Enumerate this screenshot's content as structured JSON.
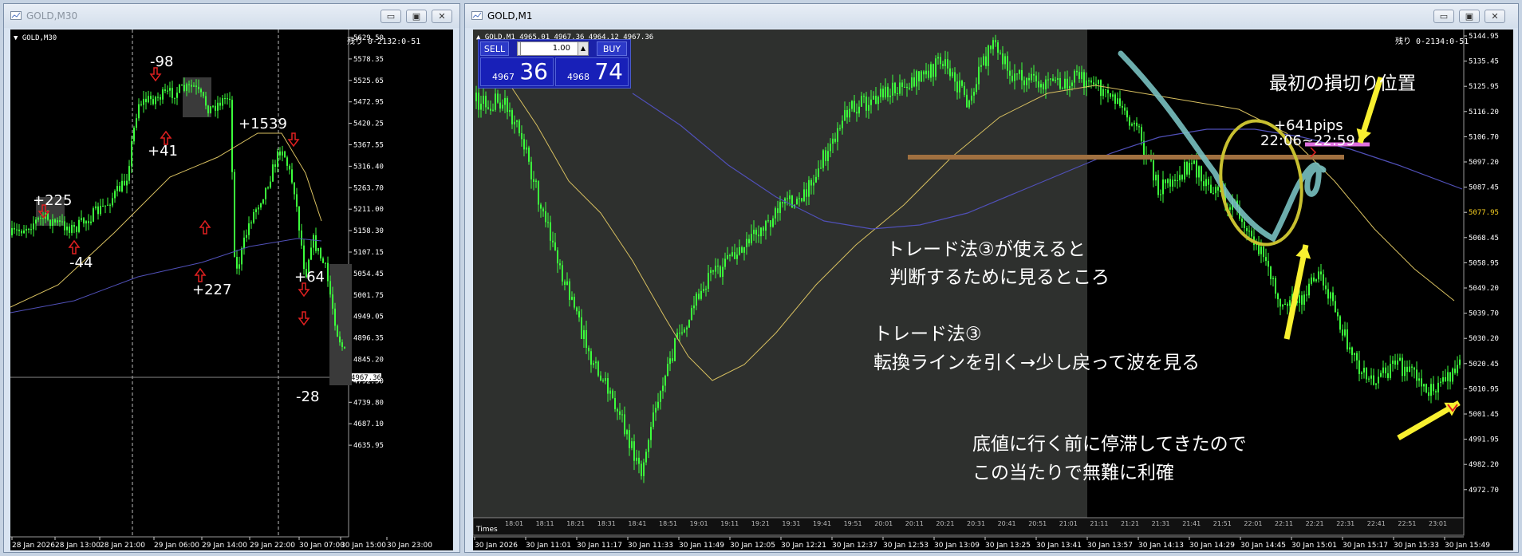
{
  "left_window": {
    "title": "GOLD,M30",
    "chart_label": "GOLD,M30",
    "countdown": "残り 0-2132:0-51",
    "current_price": "4967.36",
    "price_axis": [
      "5629.50",
      "5578.35",
      "5525.65",
      "5472.95",
      "5420.25",
      "5367.55",
      "5316.40",
      "5263.70",
      "5211.00",
      "5158.30",
      "5107.15",
      "5054.45",
      "5001.75",
      "4949.05",
      "4896.35",
      "4845.20",
      "4792.50",
      "4739.80",
      "4687.10",
      "4635.95"
    ],
    "time_axis": [
      "28 Jan 2026",
      "28 Jan 13:00",
      "28 Jan 21:00",
      "29 Jan 06:00",
      "29 Jan 14:00",
      "29 Jan 22:00",
      "30 Jan 07:00",
      "30 Jan 15:00",
      "30 Jan 23:00"
    ],
    "trade_labels": [
      "+225",
      "-44",
      "-98",
      "+41",
      "+1539",
      "+227",
      "+64",
      "-28"
    ]
  },
  "right_window": {
    "title": "GOLD,M1",
    "chart_label": "GOLD,M1",
    "ohlc": "4965.01 4967.36 4964.12 4967.36",
    "countdown": "残り 0-2134:0-51",
    "price_axis": [
      "5144.95",
      "5135.45",
      "5125.95",
      "5116.20",
      "5106.70",
      "5097.20",
      "5087.45",
      "5077.95",
      "5068.45",
      "5058.95",
      "5049.20",
      "5039.70",
      "5030.20",
      "5020.45",
      "5010.95",
      "5001.45",
      "4991.95",
      "4982.20",
      "4972.70"
    ],
    "highlight_price": "5077.95",
    "time_axis": [
      "30 Jan 2026",
      "30 Jan 11:01",
      "30 Jan 11:17",
      "30 Jan 11:33",
      "30 Jan 11:49",
      "30 Jan 12:05",
      "30 Jan 12:21",
      "30 Jan 12:37",
      "30 Jan 12:53",
      "30 Jan 13:09",
      "30 Jan 13:25",
      "30 Jan 13:41",
      "30 Jan 13:57",
      "30 Jan 14:13",
      "30 Jan 14:29",
      "30 Jan 14:45",
      "30 Jan 15:01",
      "30 Jan 15:17",
      "30 Jan 15:33",
      "30 Jan 15:49"
    ],
    "subpanel_times": [
      "18:01",
      "18:11",
      "18:21",
      "18:31",
      "18:41",
      "18:51",
      "19:01",
      "19:11",
      "19:21",
      "19:31",
      "19:41",
      "19:51",
      "20:01",
      "20:11",
      "20:21",
      "20:31",
      "20:41",
      "20:51",
      "21:01",
      "21:11",
      "21:21",
      "21:31",
      "21:41",
      "21:51",
      "22:01",
      "22:11",
      "22:21",
      "22:31",
      "22:41",
      "22:51",
      "23:01"
    ],
    "subpanel_label": "Times",
    "trade_panel": {
      "sell_label": "SELL",
      "buy_label": "BUY",
      "lot": "1.00",
      "sell_small": "4967",
      "sell_big": "36",
      "buy_small": "4968",
      "buy_big": "74"
    },
    "pips_label": "+641pips",
    "time_range_label": "22:06~22:59",
    "annotations": {
      "stop_loss": "最初の損切り位置",
      "judge_line1": "トレード法③が使えると",
      "judge_line2": "判断するために見るところ",
      "method_line1": "トレード法③",
      "method_line2": "転換ラインを引く→少し戻って波を見る",
      "profit_line1": "底値に行く前に停滞してきたので",
      "profit_line2": "この当たりで無難に利確"
    }
  },
  "colors": {
    "candle": "#3cff3c",
    "ma_fast": "#d8c060",
    "ma_slow": "#5050b8",
    "annotation_arrow": "#f8f030",
    "circle": "#c8c030",
    "brush": "#78c0c0",
    "turn_line": "#a07040",
    "stop_line": "#e070e0"
  }
}
